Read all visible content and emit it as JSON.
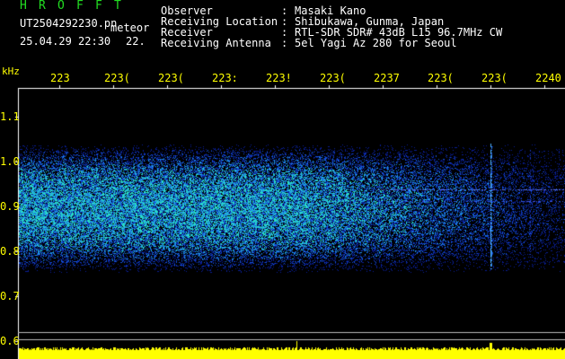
{
  "header": {
    "program_letters": [
      "H",
      "R",
      "O",
      "F",
      "F",
      "T"
    ],
    "filename": "UT2504292230.pn",
    "mode": "meteor",
    "datetime": "25.04.29 22:30",
    "clipped_value": "22."
  },
  "metadata": [
    {
      "label": "Observer",
      "sep": ":",
      "value": "Masaki Kano"
    },
    {
      "label": "Receiving Location",
      "sep": ":",
      "value": "Shibukawa, Gunma, Japan"
    },
    {
      "label": "Receiver",
      "sep": ":",
      "value": "RTL-SDR SDR# 43dB L15 96.7MHz CW"
    },
    {
      "label": "Receiving Antenna",
      "sep": ":",
      "value": "5el Yagi Az 280 for Seoul"
    }
  ],
  "axes": {
    "y_unit": "kHz",
    "y_ticks": [
      "1.1",
      "1.0",
      "0.9",
      "0.8",
      "0.7",
      "0.6"
    ],
    "x_ticks": [
      "223",
      "223(",
      "223(",
      "223:",
      "223!",
      "223(",
      "2237",
      "223(",
      "223(",
      "2240"
    ]
  },
  "colors": {
    "title": "#22dd22",
    "labels": "#ffffff",
    "ticks": "#ffff00",
    "background": "#000000",
    "strip": "#ffff00"
  }
}
